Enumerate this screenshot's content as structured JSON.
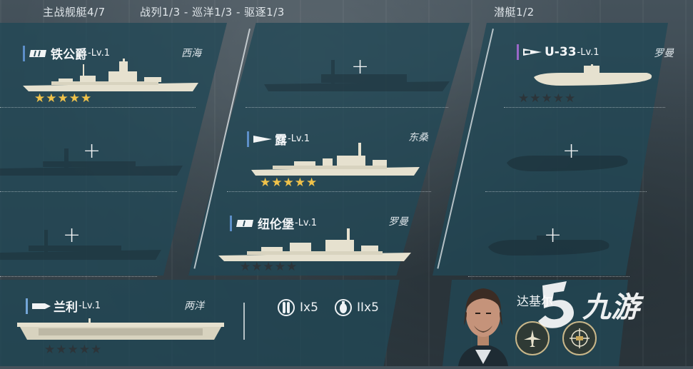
{
  "headers": {
    "main": "主战舰艇4/7",
    "surface": "战列1/3 - 巡洋1/3 - 驱逐1/3",
    "submarine": "潜艇1/2"
  },
  "battleship": {
    "name": "铁公爵",
    "level": "-Lv.1",
    "region": "西海",
    "stars": "★★★★★",
    "star_count": 5
  },
  "destroyer": {
    "name": "露",
    "level": "-Lv.1",
    "region": "东桑",
    "stars": "★★★★★",
    "star_count": 5
  },
  "cruiser": {
    "name": "纽伦堡",
    "level": "-Lv.1",
    "region": "罗曼",
    "stars": "★★★★★",
    "star_count": 0
  },
  "submarine": {
    "name": "U-33",
    "level": "-Lv.1",
    "region": "罗曼",
    "stars": "★★★★★",
    "star_count": 0
  },
  "carrier": {
    "name": "兰利",
    "level": "-Lv.1",
    "region": "两洋",
    "stars": "★★★★★",
    "star_count": 0
  },
  "empty_slot_symbol": "+",
  "ammo": {
    "torpedo": "Ix5",
    "bomb": "IIx5"
  },
  "commander": {
    "name": "达基尔"
  },
  "watermark": {
    "text": "九游"
  },
  "colors": {
    "star_gold": "#f0c24a",
    "panel": "#214856",
    "accent_blue": "#5d8fc9",
    "accent_purple": "#9a67c8"
  }
}
